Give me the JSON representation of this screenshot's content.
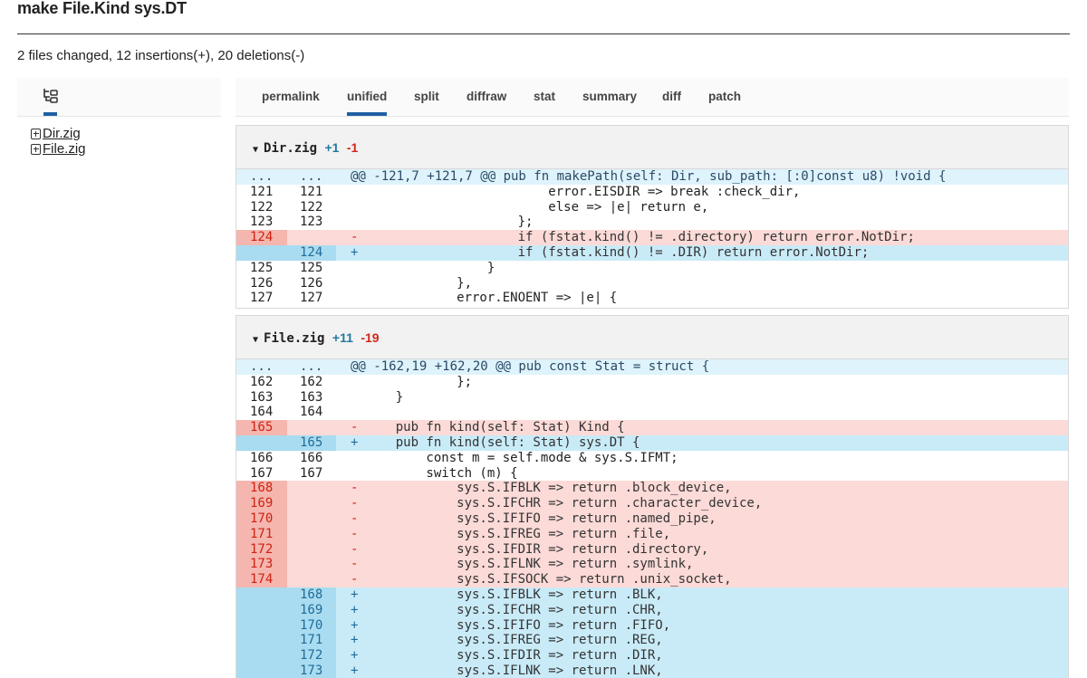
{
  "commit": {
    "title": "make File.Kind sys.DT",
    "stats": "2 files changed, 12 insertions(+), 20 deletions(-)"
  },
  "filetree": {
    "icon": "tree-icon",
    "files": [
      {
        "name": "Dir.zig",
        "icon": "added-square-icon"
      },
      {
        "name": "File.zig",
        "icon": "added-square-icon"
      }
    ]
  },
  "tabs": [
    {
      "label": "permalink"
    },
    {
      "label": "unified",
      "active": true
    },
    {
      "label": "split"
    },
    {
      "label": "diffraw"
    },
    {
      "label": "stat"
    },
    {
      "label": "summary"
    },
    {
      "label": "diff"
    },
    {
      "label": "patch"
    }
  ],
  "colors": {
    "accent": "#1f5fa3",
    "added": "#c9ebf8",
    "removed": "#fbdad7",
    "removed_text": "#cf2214",
    "added_text": "#1f6c9a"
  },
  "files": [
    {
      "name": "Dir.zig",
      "caret": "▼",
      "additions": "+1",
      "deletions": "-1",
      "lines": [
        {
          "type": "hunk",
          "old": "...",
          "new": "...",
          "sign": "",
          "text": "@@ -121,7 +121,7 @@ pub fn makePath(self: Dir, sub_path: [:0]const u8) !void {"
        },
        {
          "type": "ctx",
          "old": "121",
          "new": "121",
          "sign": "",
          "text": "                        error.EISDIR => break :check_dir,"
        },
        {
          "type": "ctx",
          "old": "122",
          "new": "122",
          "sign": "",
          "text": "                        else => |e| return e,"
        },
        {
          "type": "ctx",
          "old": "123",
          "new": "123",
          "sign": "",
          "text": "                    };"
        },
        {
          "type": "del",
          "old": "124",
          "new": "",
          "sign": "-",
          "text": "                    if (fstat.kind() != .directory) return error.NotDir;"
        },
        {
          "type": "add",
          "old": "",
          "new": "124",
          "sign": "+",
          "text": "                    if (fstat.kind() != .DIR) return error.NotDir;"
        },
        {
          "type": "ctx",
          "old": "125",
          "new": "125",
          "sign": "",
          "text": "                }"
        },
        {
          "type": "ctx",
          "old": "126",
          "new": "126",
          "sign": "",
          "text": "            },"
        },
        {
          "type": "ctx",
          "old": "127",
          "new": "127",
          "sign": "",
          "text": "            error.ENOENT => |e| {"
        }
      ]
    },
    {
      "name": "File.zig",
      "caret": "▼",
      "additions": "+11",
      "deletions": "-19",
      "lines": [
        {
          "type": "hunk",
          "old": "...",
          "new": "...",
          "sign": "",
          "text": "@@ -162,19 +162,20 @@ pub const Stat = struct {"
        },
        {
          "type": "ctx",
          "old": "162",
          "new": "162",
          "sign": "",
          "text": "            };"
        },
        {
          "type": "ctx",
          "old": "163",
          "new": "163",
          "sign": "",
          "text": "    }"
        },
        {
          "type": "ctx",
          "old": "164",
          "new": "164",
          "sign": "",
          "text": ""
        },
        {
          "type": "del",
          "old": "165",
          "new": "",
          "sign": "-",
          "text": "    pub fn kind(self: Stat) Kind {"
        },
        {
          "type": "add",
          "old": "",
          "new": "165",
          "sign": "+",
          "text": "    pub fn kind(self: Stat) sys.DT {"
        },
        {
          "type": "ctx",
          "old": "166",
          "new": "166",
          "sign": "",
          "text": "        const m = self.mode & sys.S.IFMT;"
        },
        {
          "type": "ctx",
          "old": "167",
          "new": "167",
          "sign": "",
          "text": "        switch (m) {"
        },
        {
          "type": "del",
          "old": "168",
          "new": "",
          "sign": "-",
          "text": "            sys.S.IFBLK => return .block_device,"
        },
        {
          "type": "del",
          "old": "169",
          "new": "",
          "sign": "-",
          "text": "            sys.S.IFCHR => return .character_device,"
        },
        {
          "type": "del",
          "old": "170",
          "new": "",
          "sign": "-",
          "text": "            sys.S.IFIFO => return .named_pipe,"
        },
        {
          "type": "del",
          "old": "171",
          "new": "",
          "sign": "-",
          "text": "            sys.S.IFREG => return .file,"
        },
        {
          "type": "del",
          "old": "172",
          "new": "",
          "sign": "-",
          "text": "            sys.S.IFDIR => return .directory,"
        },
        {
          "type": "del",
          "old": "173",
          "new": "",
          "sign": "-",
          "text": "            sys.S.IFLNK => return .symlink,"
        },
        {
          "type": "del",
          "old": "174",
          "new": "",
          "sign": "-",
          "text": "            sys.S.IFSOCK => return .unix_socket,"
        },
        {
          "type": "add",
          "old": "",
          "new": "168",
          "sign": "+",
          "text": "            sys.S.IFBLK => return .BLK,"
        },
        {
          "type": "add",
          "old": "",
          "new": "169",
          "sign": "+",
          "text": "            sys.S.IFCHR => return .CHR,"
        },
        {
          "type": "add",
          "old": "",
          "new": "170",
          "sign": "+",
          "text": "            sys.S.IFIFO => return .FIFO,"
        },
        {
          "type": "add",
          "old": "",
          "new": "171",
          "sign": "+",
          "text": "            sys.S.IFREG => return .REG,"
        },
        {
          "type": "add",
          "old": "",
          "new": "172",
          "sign": "+",
          "text": "            sys.S.IFDIR => return .DIR,"
        },
        {
          "type": "add",
          "old": "",
          "new": "173",
          "sign": "+",
          "text": "            sys.S.IFLNK => return .LNK,"
        }
      ]
    }
  ]
}
